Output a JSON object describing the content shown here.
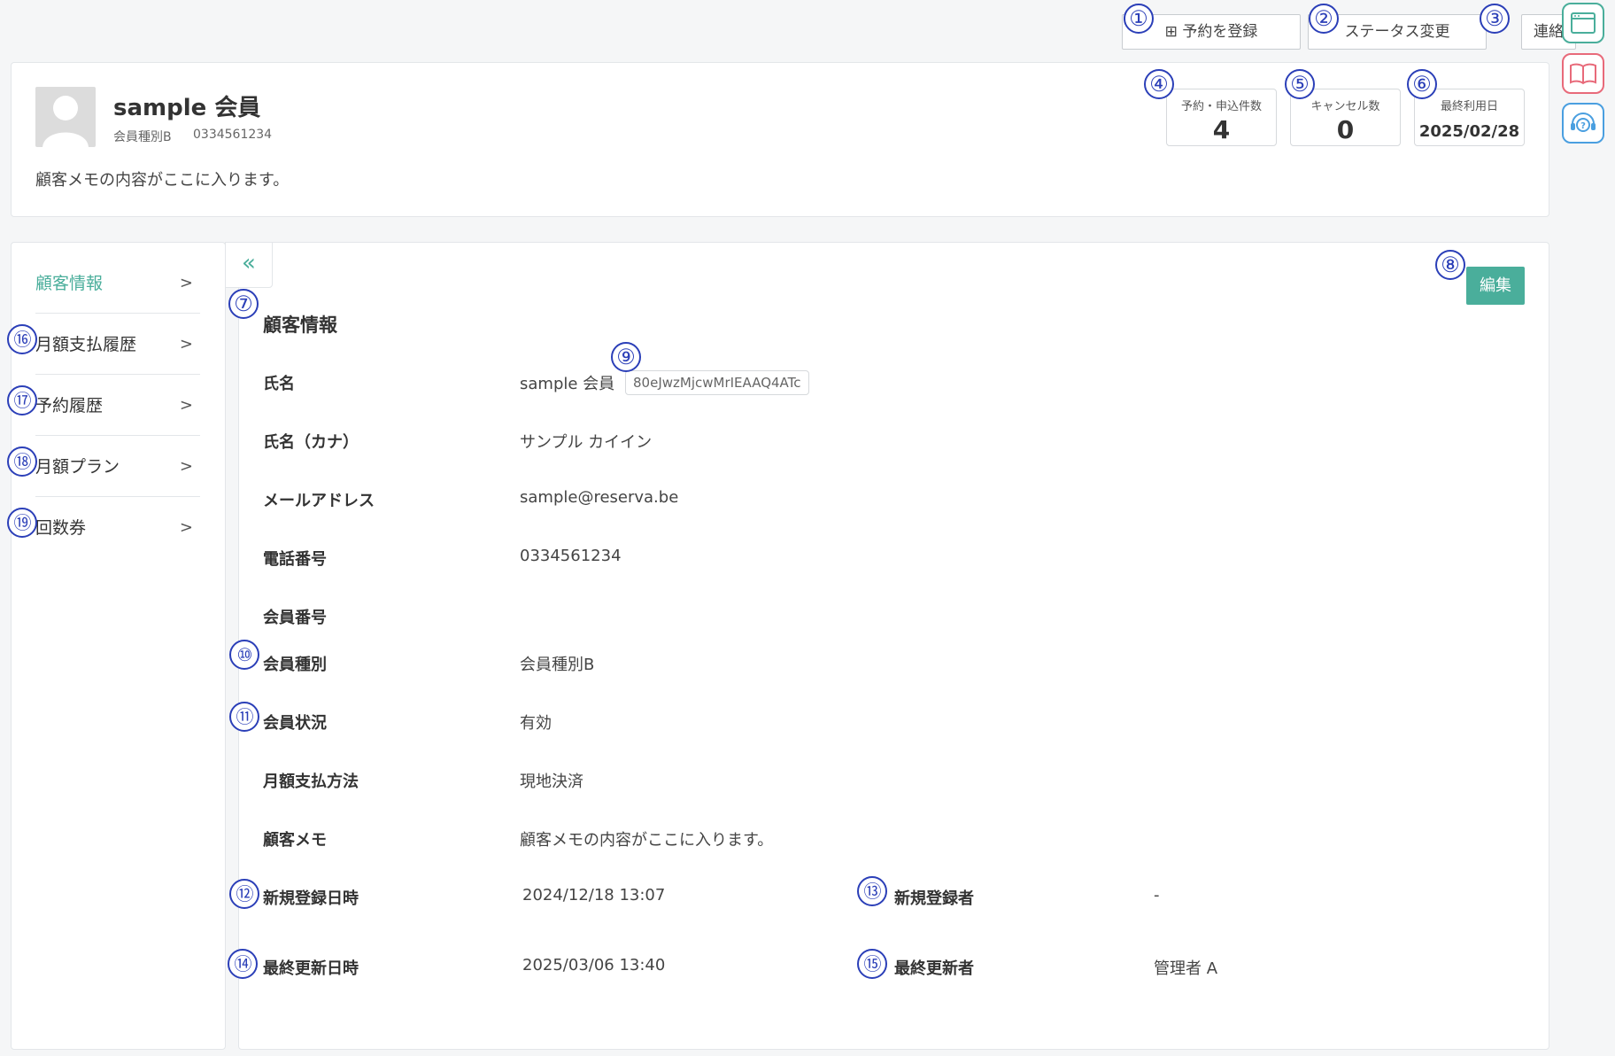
{
  "toolbar": {
    "register_reservation": "⊞ 予約を登録",
    "change_status": "ステータス変更",
    "contact": "連絡"
  },
  "markers": [
    "①",
    "②",
    "③",
    "④",
    "⑤",
    "⑥",
    "⑦",
    "⑧",
    "⑨",
    "⑩",
    "⑪",
    "⑫",
    "⑬",
    "⑭",
    "⑮",
    "⑯",
    "⑰",
    "⑱",
    "⑲"
  ],
  "customer": {
    "name": "sample 会員",
    "member_type": "会員種別B",
    "phone": "0334561234",
    "memo": "顧客メモの内容がここに入ります。"
  },
  "stats": {
    "reservations_label": "予約・申込件数",
    "reservations_value": "4",
    "cancellations_label": "キャンセル数",
    "cancellations_value": "0",
    "last_use_label": "最終利用日",
    "last_use_value": "2025/02/28"
  },
  "sidebar": {
    "collapse_icon": "«",
    "items": [
      {
        "label": "顧客情報"
      },
      {
        "label": "月額支払履歴"
      },
      {
        "label": "予約履歴"
      },
      {
        "label": "月額プラン"
      },
      {
        "label": "回数券"
      }
    ]
  },
  "detail": {
    "title": "顧客情報",
    "edit_label": "編集",
    "id_tag": "80eJwzMjcwMrIEAAQ4ATc",
    "rows": [
      {
        "label": "氏名",
        "value": "sample 会員"
      },
      {
        "label": "氏名（カナ）",
        "value": "サンプル カイイン"
      },
      {
        "label": "メールアドレス",
        "value": "sample@reserva.be"
      },
      {
        "label": "電話番号",
        "value": "0334561234"
      },
      {
        "label": "会員番号",
        "value": ""
      },
      {
        "label": "会員種別",
        "value": "会員種別B"
      },
      {
        "label": "会員状況",
        "value": "有効"
      },
      {
        "label": "月額支払方法",
        "value": "現地決済"
      },
      {
        "label": "顧客メモ",
        "value": "顧客メモの内容がここに入ります。"
      }
    ],
    "created_at_label": "新規登録日時",
    "created_at": "2024/12/18 13:07",
    "created_by_label": "新規登録者",
    "created_by": "-",
    "updated_at_label": "最終更新日時",
    "updated_at": "2025/03/06 13:40",
    "updated_by_label": "最終更新者",
    "updated_by": "管理者 A"
  },
  "colors": {
    "accent": "#4aae9b",
    "marker": "#2b3fb8"
  }
}
